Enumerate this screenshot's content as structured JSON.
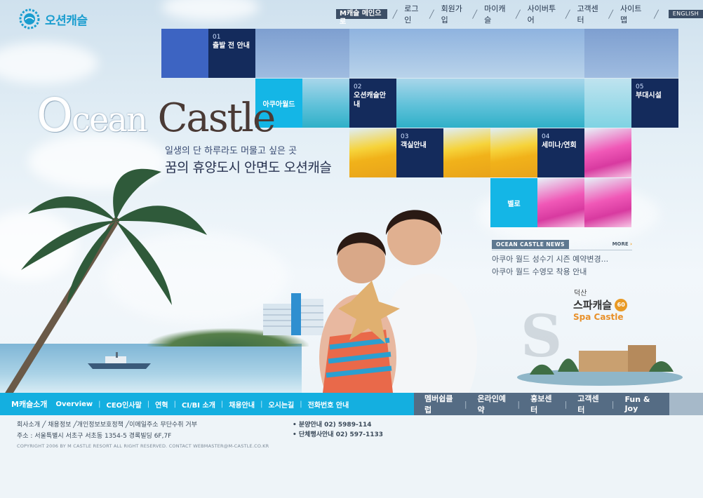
{
  "colors": {
    "accent_cyan": "#14b6e6",
    "navy": "#142b5c",
    "slate": "#556c84",
    "orange": "#e8902a"
  },
  "logo": {
    "text": "오션캐슬",
    "icon": "sun-gear-icon"
  },
  "topnav": {
    "main_button": "M캐슬 메인으로",
    "links": [
      "로그인",
      "회원가입",
      "마이캐슬",
      "사이버투어",
      "고객센터",
      "사이트 맵"
    ],
    "english_button": "ENGLISH"
  },
  "tiles": [
    {
      "num": "01",
      "title": "출발 전 안내"
    },
    {
      "num": "",
      "title": "아쿠아월드"
    },
    {
      "num": "02",
      "title": "오션캐슬안내"
    },
    {
      "num": "05",
      "title": "부대시설"
    },
    {
      "num": "03",
      "title": "객실안내"
    },
    {
      "num": "04",
      "title": "세미나/연회"
    },
    {
      "num": "",
      "title": "벨로"
    }
  ],
  "brand": {
    "title_o": "O",
    "title_ocean": "cean",
    "title_castle": " Castle",
    "tagline1": "일생의 단 하루라도 머물고 싶은 곳",
    "tagline2": "꿈의 휴양도시 안면도 오션캐슬"
  },
  "news": {
    "badge": "OCEAN CASTLE NEWS",
    "more": "MORE",
    "items": [
      "아쿠아 월드 성수기 시즌 예약변경...",
      "아쿠아 월드 수영모 착용 안내"
    ]
  },
  "spa": {
    "sub": "덕산",
    "name": "스파캐슬",
    "badge": "60",
    "en": "Spa Castle",
    "watermark": "S"
  },
  "bottomnav": {
    "head": "M캐슬소개",
    "left_items": [
      "Overview",
      "CEO인사말",
      "연혁",
      "CI/BI 소개",
      "채용안내",
      "오시는길",
      "전화번호 안내"
    ],
    "right_items": [
      "멤버쉽클럽",
      "온라인예약",
      "홍보센터",
      "고객센터",
      "Fun & Joy"
    ]
  },
  "footer": {
    "links_line": "회사소개 ╱ 채용정보 ╱개인정보보호정책 ╱이메일주소 무단수취 거부",
    "address": "주소 : 서울특별시 서초구 서초동 1354-5 경록빌딩 6F,7F",
    "copyright": "COPYRIGHT 2006 BY M CASTLE RESORT ALL RIGHT RESERVED. CONTACT WEBMASTER@M-CASTLE.CO.KR",
    "contact1": "• 분양안내 02) 5989-114",
    "contact2": "• 단체행사안내 02) 597-1133"
  }
}
